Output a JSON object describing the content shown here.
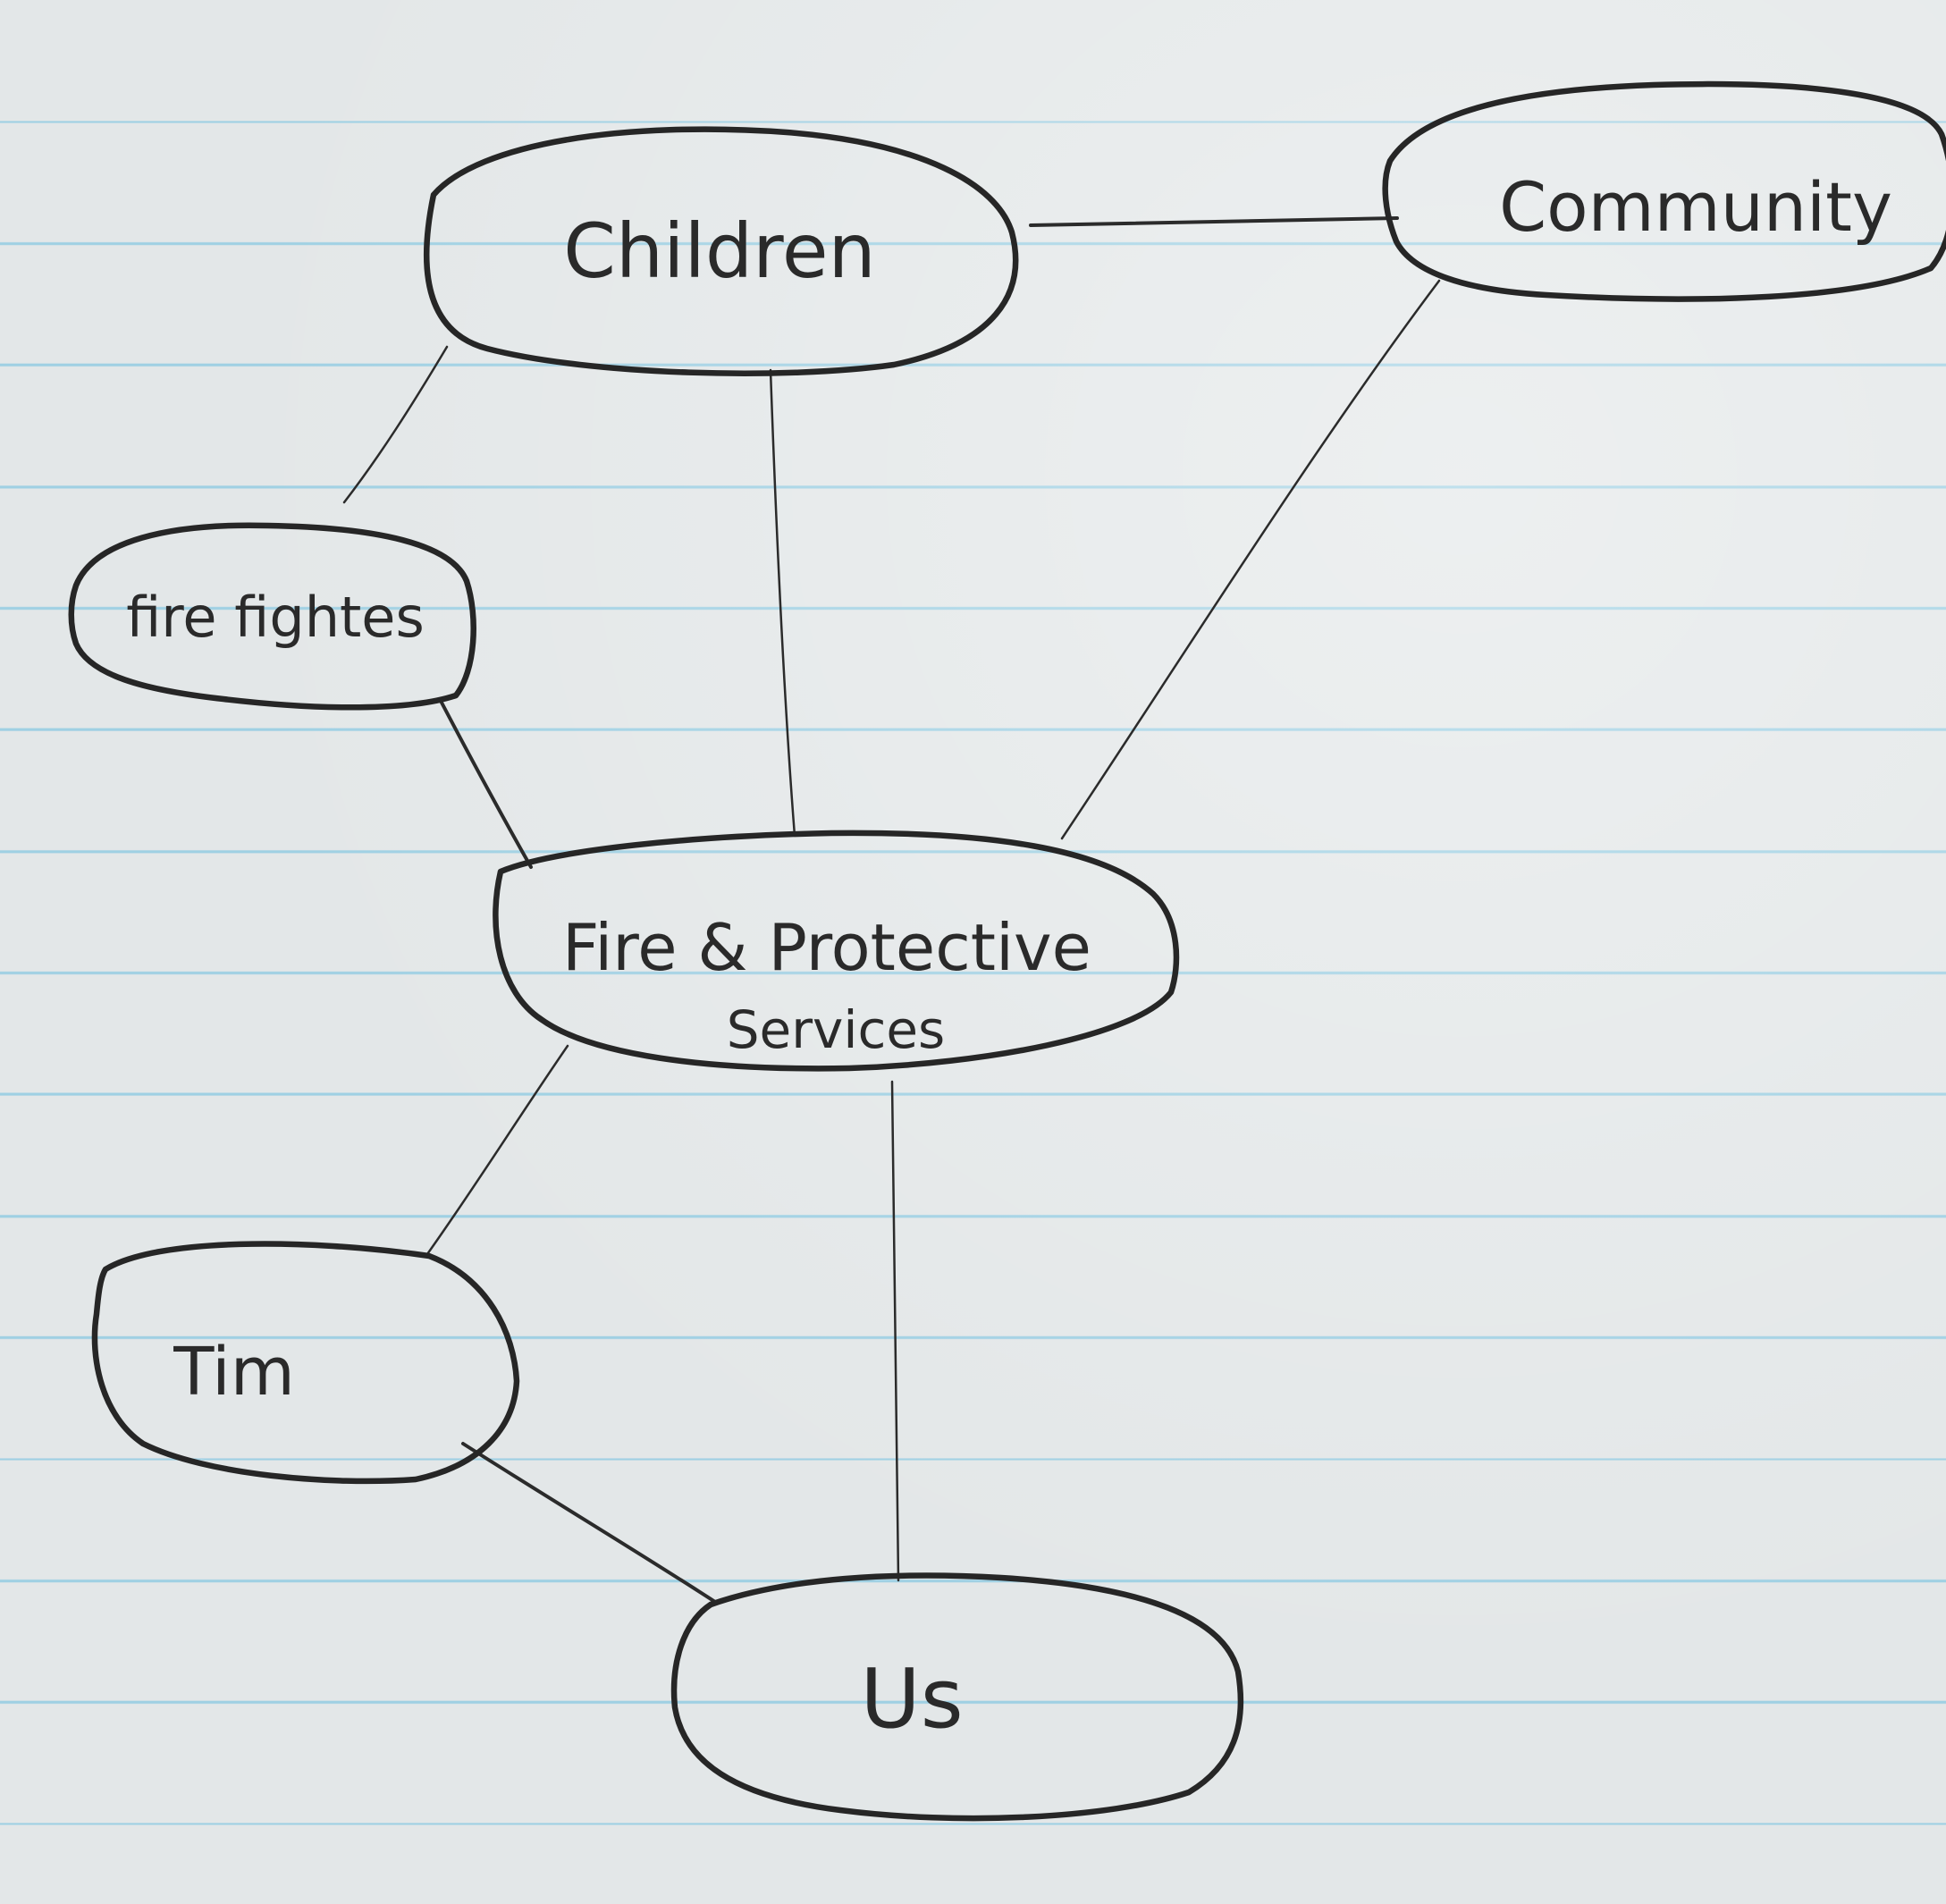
{
  "diagram": {
    "nodes": [
      {
        "id": "children",
        "lines": [
          "Children"
        ]
      },
      {
        "id": "community",
        "lines": [
          "Community"
        ]
      },
      {
        "id": "firefighters",
        "lines": [
          "fire fightes"
        ]
      },
      {
        "id": "fire-protective",
        "lines": [
          "Fire & Protective",
          "Services"
        ]
      },
      {
        "id": "tim",
        "lines": [
          "Tim"
        ]
      },
      {
        "id": "us",
        "lines": [
          "Us"
        ]
      }
    ],
    "edges": [
      [
        "children",
        "community"
      ],
      [
        "children",
        "firefighters"
      ],
      [
        "children",
        "fire-protective"
      ],
      [
        "community",
        "fire-protective"
      ],
      [
        "firefighters",
        "fire-protective"
      ],
      [
        "fire-protective",
        "tim"
      ],
      [
        "fire-protective",
        "us"
      ],
      [
        "tim",
        "us"
      ]
    ]
  }
}
